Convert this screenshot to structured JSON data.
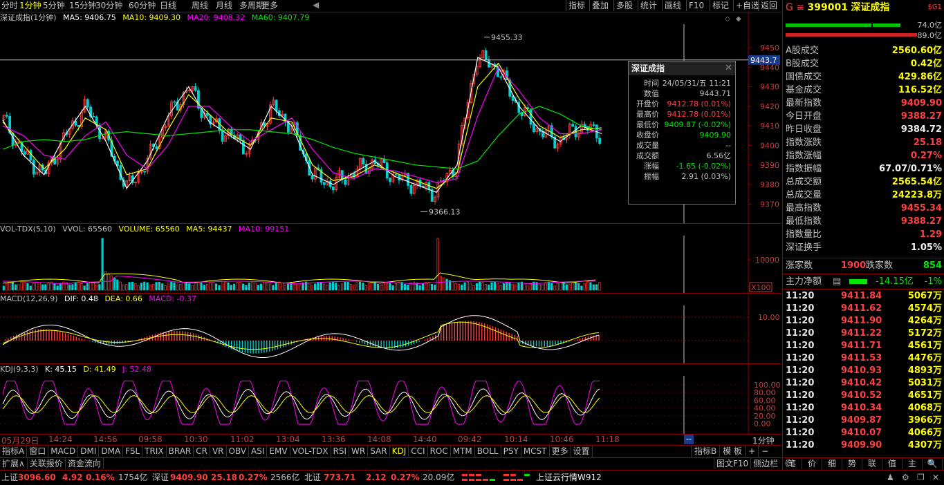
{
  "toolbar": {
    "periods": [
      "分时",
      "1分钟",
      "5分钟",
      "15分钟",
      "30分钟",
      "60分钟",
      "日线",
      "周线",
      "月线",
      "多周期",
      "更多"
    ],
    "selected_period": "1分钟",
    "right_buttons": [
      "指标",
      "叠加",
      "多股",
      "统计",
      "画线",
      "F10",
      "标记",
      "+自选",
      "返回"
    ]
  },
  "main_pane": {
    "legend_name": "深证成指(1分钟)",
    "ma5": "MA5: 9406.75",
    "ma10": "MA10: 9409.30",
    "ma20": "MA20: 9408.32",
    "ma60": "MA60: 9407.79",
    "y_ticks": [
      "9450",
      "9440",
      "9430",
      "9420",
      "9410",
      "9400",
      "9390",
      "9380",
      "9370"
    ],
    "high_label": "9455.33",
    "low_label": "9366.13",
    "cursor_value": "9443.7",
    "colors": {
      "ma5": "#ffffff",
      "ma10": "#ffff00",
      "ma20": "#ff00ff",
      "ma60": "#00e600",
      "up": "#ff4040",
      "down": "#00d0d0"
    }
  },
  "vol_pane": {
    "legend_name": "VOL-TDX(5,10)",
    "vvol": "VVOL: 65560",
    "volume": "VOLUME: 65560",
    "ma5": "MA5: 94437",
    "ma10": "MA10: 99151",
    "y_tick": "10000",
    "unit": "X100"
  },
  "macd_pane": {
    "legend_name": "MACD(12,26,9)",
    "dif": "DIF: 0.48",
    "dea": "DEA: 0.66",
    "macd": "MACD: -0.37",
    "y_tick": "10.00"
  },
  "kdj_pane": {
    "legend_name": "KDJ(9,3,3)",
    "k": "K: 45.15",
    "d": "D: 41.49",
    "j": "J: 52.48",
    "y_ticks": [
      "100.00",
      "80.00",
      "60.00",
      "40.00",
      "20.00",
      "0.00"
    ]
  },
  "time_axis": [
    "05月29日",
    "14:24",
    "14:56",
    "09:58",
    "10:30",
    "11:02",
    "13:04",
    "13:36",
    "14:08",
    "14:40",
    "09:42",
    "10:14",
    "10:46",
    "11:18"
  ],
  "time_right": "1分钟",
  "popup": {
    "title": "深证成指",
    "rows": [
      {
        "k": "时间",
        "v": "24/05/31/五 11:21",
        "c": "#c0c0c0"
      },
      {
        "k": "数值",
        "v": "9443.71",
        "c": "#c0c0c0"
      },
      {
        "k": "开盘价",
        "v": "9412.78 (0.01%)",
        "c": "#ff4040"
      },
      {
        "k": "最高价",
        "v": "9412.78 (0.01%)",
        "c": "#ff4040"
      },
      {
        "k": "最低价",
        "v": "9409.87 (-0.02%)",
        "c": "#00e600"
      },
      {
        "k": "收盘价",
        "v": "9409.90",
        "c": "#00e600"
      },
      {
        "k": "成交量",
        "v": "--",
        "c": "#c0c0c0"
      },
      {
        "k": "成交额",
        "v": "6.56亿",
        "c": "#c0c0c0"
      },
      {
        "k": "涨幅",
        "v": "-1.65 (-0.02%)",
        "c": "#00e600"
      },
      {
        "k": "振幅",
        "v": "2.91 (0.03%)",
        "c": "#c0c0c0"
      }
    ]
  },
  "indicator_tabs": [
    "指标A",
    "窗口",
    "MACD",
    "DMI",
    "DMA",
    "FSL",
    "TRIX",
    "BRAR",
    "CR",
    "VR",
    "OBV",
    "ASI",
    "EMV",
    "VOL-TDX",
    "RSI",
    "WR",
    "SAR",
    "KDJ",
    "CCI",
    "ROC",
    "MTM",
    "BOLL",
    "PSY",
    "MCST",
    "更多",
    "设置"
  ],
  "indicator_selected": "KDJ",
  "indicator_right": [
    "指标B",
    "模 板",
    "+",
    "−"
  ],
  "row3_tabs": [
    "扩展∧",
    "关联报价",
    "资金流向"
  ],
  "row3_right": [
    "图文F10",
    "侧边栏 《"
  ],
  "right_panel": {
    "header_prefix": "G",
    "code": "399001",
    "name": "深证成指",
    "badge": "$G1",
    "buy_amount": "74.0亿",
    "sell_amount": "89.0亿",
    "rows": [
      {
        "k": "A股成交",
        "v": "2560.60亿",
        "c": "yellow"
      },
      {
        "k": "B股成交",
        "v": "0.42亿",
        "c": "yellow"
      },
      {
        "k": "国债成交",
        "v": "429.86亿",
        "c": "yellow"
      },
      {
        "k": "基金成交",
        "v": "116.52亿",
        "c": "yellow"
      },
      {
        "k": "最新指数",
        "v": "9409.90",
        "c": "red"
      },
      {
        "k": "今日开盘",
        "v": "9388.27",
        "c": "red"
      },
      {
        "k": "昨日收盘",
        "v": "9384.72",
        "c": "white"
      },
      {
        "k": "指数涨跌",
        "v": "25.18",
        "c": "red"
      },
      {
        "k": "指数涨幅",
        "v": "0.27%",
        "c": "red"
      },
      {
        "k": "指数振幅",
        "v": "67.07/0.71%",
        "c": "white"
      },
      {
        "k": "总成交额",
        "v": "2565.54亿",
        "c": "yellow"
      },
      {
        "k": "总成交量",
        "v": "24223.8万",
        "c": "yellow"
      },
      {
        "k": "最高指数",
        "v": "9455.34",
        "c": "red"
      },
      {
        "k": "最低指数",
        "v": "9388.27",
        "c": "red"
      },
      {
        "k": "指数量比",
        "v": "1.29",
        "c": "red"
      },
      {
        "k": "深证换手",
        "v": "1.05%",
        "c": "white"
      }
    ],
    "adv_label": "涨家数",
    "adv_value": "1900",
    "dec_label": "跌家数",
    "dec_value": "854",
    "mainflow_label": "主力净额",
    "mainflow_value": "-14.15亿",
    "mainflow_pct": "-1%",
    "ticks": [
      {
        "t": "11:20",
        "p": "9411.84",
        "v": "5067万"
      },
      {
        "t": "11:20",
        "p": "9411.62",
        "v": "4574万"
      },
      {
        "t": "11:20",
        "p": "9411.90",
        "v": "4264万"
      },
      {
        "t": "11:20",
        "p": "9411.22",
        "v": "5172万"
      },
      {
        "t": "11:20",
        "p": "9411.71",
        "v": "4561万"
      },
      {
        "t": "11:20",
        "p": "9411.53",
        "v": "4476万"
      },
      {
        "t": "11:20",
        "p": "9410.93",
        "v": "4893万"
      },
      {
        "t": "11:20",
        "p": "9410.42",
        "v": "5031万"
      },
      {
        "t": "11:20",
        "p": "9410.52",
        "v": "4651万"
      },
      {
        "t": "11:20",
        "p": "9410.34",
        "v": "4068万"
      },
      {
        "t": "11:20",
        "p": "9409.87",
        "v": "3966万"
      },
      {
        "t": "11:20",
        "p": "9410.07",
        "v": "4066万"
      },
      {
        "t": "11:20",
        "p": "9409.90",
        "v": "4307万"
      }
    ],
    "bottom_tabs": [
      "笔",
      "价",
      "细",
      "势",
      "联",
      "值",
      "主",
      "🔍"
    ]
  },
  "status": {
    "sh_label": "上证",
    "sh_value": "3096.60",
    "sh_chg": "4.92",
    "sh_pct": "0.16%",
    "sh_amt": "1754亿",
    "sz_label": "深证",
    "sz_value": "9409.90",
    "sz_chg": "25.18",
    "sz_pct": "0.27%",
    "sz_amt": "2566亿",
    "bz_label": "北证",
    "bz_value": "773.71",
    "bz_chg": "2.12",
    "bz_pct": "0.27%",
    "bz_amt": "20.09亿",
    "ticker": "上证云行情W912"
  },
  "chart_data": {
    "type": "line",
    "title": "深证成指(1分钟)",
    "ylim": [
      9362,
      9462
    ],
    "x_tick_labels": [
      "05月29日",
      "14:24",
      "14:56",
      "09:58",
      "10:30",
      "11:02",
      "13:04",
      "13:36",
      "14:08",
      "14:40",
      "09:42",
      "10:14",
      "10:46",
      "11:18"
    ],
    "series": [
      {
        "name": "MA5",
        "values": [
          9413,
          9395,
          9385,
          9405,
          9420,
          9402,
          9378,
          9392,
          9415,
          9430,
          9412,
          9405,
          9398,
          9420,
          9410,
          9385,
          9380,
          9386,
          9392,
          9384,
          9380,
          9376,
          9390,
          9445,
          9440,
          9420,
          9408,
          9402,
          9410,
          9406
        ]
      },
      {
        "name": "MA10",
        "values": [
          9412,
          9400,
          9388,
          9398,
          9414,
          9408,
          9385,
          9388,
          9408,
          9426,
          9416,
          9406,
          9400,
          9414,
          9412,
          9390,
          9382,
          9384,
          9390,
          9386,
          9382,
          9378,
          9386,
          9430,
          9442,
          9424,
          9410,
          9404,
          9408,
          9409
        ]
      },
      {
        "name": "MA20",
        "values": [
          9410,
          9405,
          9395,
          9393,
          9405,
          9412,
          9395,
          9388,
          9400,
          9420,
          9420,
          9410,
          9402,
          9408,
          9414,
          9398,
          9386,
          9383,
          9388,
          9387,
          9384,
          9381,
          9383,
          9415,
          9440,
          9428,
          9414,
          9406,
          9406,
          9408
        ]
      },
      {
        "name": "MA60",
        "values": [
          9398,
          9402,
          9403,
          9402,
          9403,
          9406,
          9407,
          9406,
          9405,
          9406,
          9407,
          9408,
          9408,
          9407,
          9406,
          9403,
          9399,
          9396,
          9394,
          9392,
          9390,
          9389,
          9388,
          9392,
          9405,
          9416,
          9420,
          9416,
          9410,
          9408
        ]
      }
    ]
  }
}
